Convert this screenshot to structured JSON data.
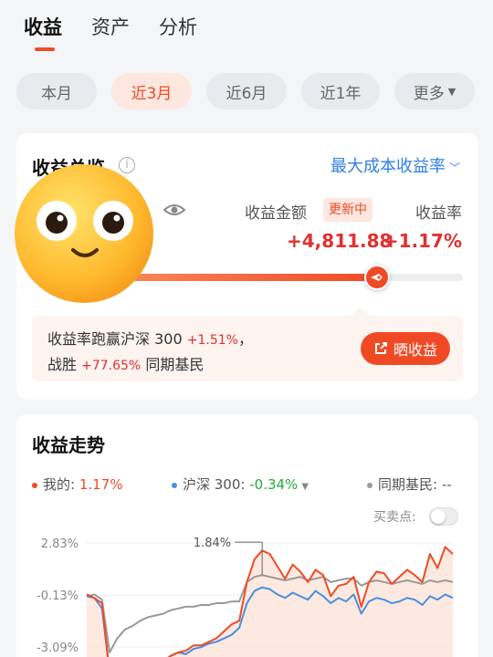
{
  "tabs": [
    {
      "label": "收益",
      "active": true
    },
    {
      "label": "资产",
      "active": false
    },
    {
      "label": "分析",
      "active": false
    }
  ],
  "periods": [
    {
      "label": "本月",
      "active": false
    },
    {
      "label": "近3月",
      "active": true
    },
    {
      "label": "近6月",
      "active": false
    },
    {
      "label": "近1年",
      "active": false
    },
    {
      "label": "更多",
      "active": false
    }
  ],
  "overview": {
    "title": "收益总览",
    "metric_selector": "最大成本收益率",
    "amount_label": "收益金额",
    "updating_badge": "更新中",
    "rate_label": "收益率",
    "amount_value": "+4,811.88",
    "rate_value": "+1.17%",
    "progress": 0.8,
    "beat": {
      "line1_prefix": "收益率跑赢沪深 300",
      "line1_value": "+1.51%",
      "line1_suffix": "，",
      "line2_prefix": "战胜",
      "line2_value": "+77.65%",
      "line2_suffix": "同期基民",
      "share_label": "晒收益"
    }
  },
  "trend": {
    "title": "收益走势",
    "legend": {
      "mine_label": "我的:",
      "mine_value": "1.17%",
      "index_label": "沪深 300:",
      "index_value": "-0.34%",
      "peers_label": "同期基民:",
      "peers_value": "--"
    },
    "trade_points_label": "买卖点:",
    "colors": {
      "mine": "#f04a25",
      "index": "#4a8fe0",
      "peers": "#999999"
    }
  },
  "chart_data": {
    "type": "line",
    "yticks": [
      "2.83%",
      "-0.13%",
      "-3.09%"
    ],
    "ylim": [
      -3.09,
      2.83
    ],
    "peak_annotation": "1.84%",
    "series": [
      {
        "name": "我的",
        "values": [
          -0.1,
          -0.3,
          -0.6,
          -4.6,
          -4.6,
          -4.6,
          -4.5,
          -4.3,
          -4.2,
          -4.0,
          -4.0,
          -3.6,
          -3.4,
          -3.3,
          -3.0,
          -3.0,
          -2.8,
          -2.6,
          -2.2,
          -1.8,
          -1.6,
          0.6,
          1.9,
          2.4,
          2.2,
          1.5,
          0.8,
          1.6,
          1.2,
          0.6,
          1.3,
          1.0,
          -0.2,
          0.4,
          0.5,
          0.9,
          -0.8,
          0.6,
          1.2,
          1.1,
          0.5,
          0.9,
          1.3,
          1.0,
          0.6,
          2.2,
          1.4,
          2.6,
          2.2
        ]
      },
      {
        "name": "沪深 300",
        "values": [
          -0.2,
          -0.3,
          -0.9,
          -4.5,
          -4.4,
          -4.6,
          -4.8,
          -4.6,
          -4.3,
          -4.1,
          -3.9,
          -3.6,
          -3.4,
          -3.5,
          -3.2,
          -3.1,
          -2.9,
          -2.8,
          -2.6,
          -2.4,
          -2.0,
          -0.6,
          0.1,
          0.3,
          0.2,
          -0.1,
          -0.3,
          0.0,
          -0.2,
          -0.4,
          0.1,
          -0.2,
          -0.6,
          -0.3,
          -0.5,
          -0.1,
          -1.2,
          -0.5,
          -0.3,
          -0.4,
          -0.6,
          -0.5,
          -0.3,
          -0.4,
          -0.7,
          -0.2,
          -0.4,
          -0.1,
          -0.3
        ]
      },
      {
        "name": "同期基民",
        "values": [
          -0.2,
          -0.1,
          -0.4,
          -3.4,
          -2.6,
          -2.1,
          -1.9,
          -1.6,
          -1.4,
          -1.3,
          -1.2,
          -1.0,
          -0.9,
          -0.8,
          -0.8,
          -0.7,
          -0.7,
          -0.6,
          -0.6,
          -0.5,
          -0.5,
          0.6,
          0.9,
          1.0,
          0.9,
          0.8,
          0.7,
          0.8,
          0.9,
          0.7,
          0.8,
          0.9,
          0.6,
          0.7,
          0.8,
          0.8,
          0.4,
          0.6,
          0.7,
          0.6,
          0.5,
          0.6,
          0.7,
          0.6,
          0.5,
          0.7,
          0.6,
          0.7,
          0.6
        ]
      }
    ]
  }
}
